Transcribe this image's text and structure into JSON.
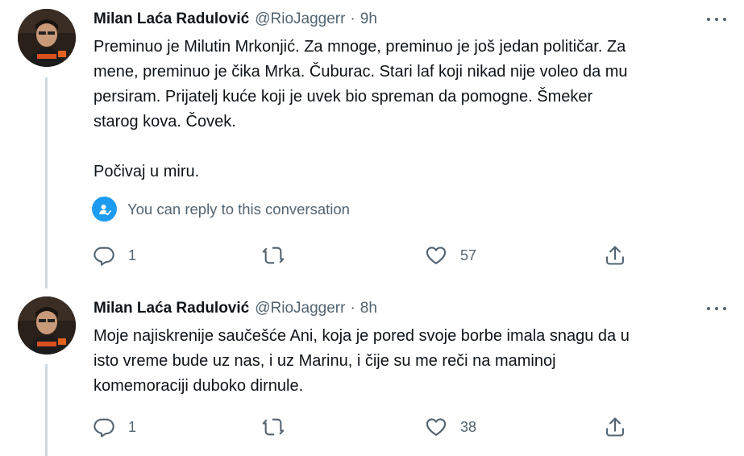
{
  "tweets": [
    {
      "author": {
        "name": "Milan Laća Radulović",
        "handle": "@RioJaggerr"
      },
      "separator": "·",
      "time": "9h",
      "text": "Preminuo je Milutin Mrkonjić. Za mnoge, preminuo je još jedan političar. Za\nmene, preminuo je čika Mrka. Čuburac. Stari laf koji nikad nije voleo da mu\npersiram. Prijatelj kuće koji je uvek bio spreman da pomogne. Šmeker\nstarog kova. Čovek.\n\nPočivaj u miru.",
      "reply_note": "You can reply to this conversation",
      "reply_count": "1",
      "retweet_count": "",
      "like_count": "57"
    },
    {
      "author": {
        "name": "Milan Laća Radulović",
        "handle": "@RioJaggerr"
      },
      "separator": "·",
      "time": "8h",
      "text": "Moje najiskrenije saučešće Ani, koja je pored svoje borbe imala snagu da u\nisto vreme bude uz nas, i uz Marinu, i čije su me reči na maminoj\nkomemoraciji duboko dirnule.",
      "reply_count": "1",
      "retweet_count": "",
      "like_count": "38"
    }
  ],
  "colors": {
    "accent": "#1d9bf0",
    "muted": "#536471",
    "thread_line": "#cfd9de"
  },
  "icons": [
    "more-icon",
    "reply-permission-icon",
    "reply-icon",
    "retweet-icon",
    "like-icon",
    "share-icon"
  ]
}
